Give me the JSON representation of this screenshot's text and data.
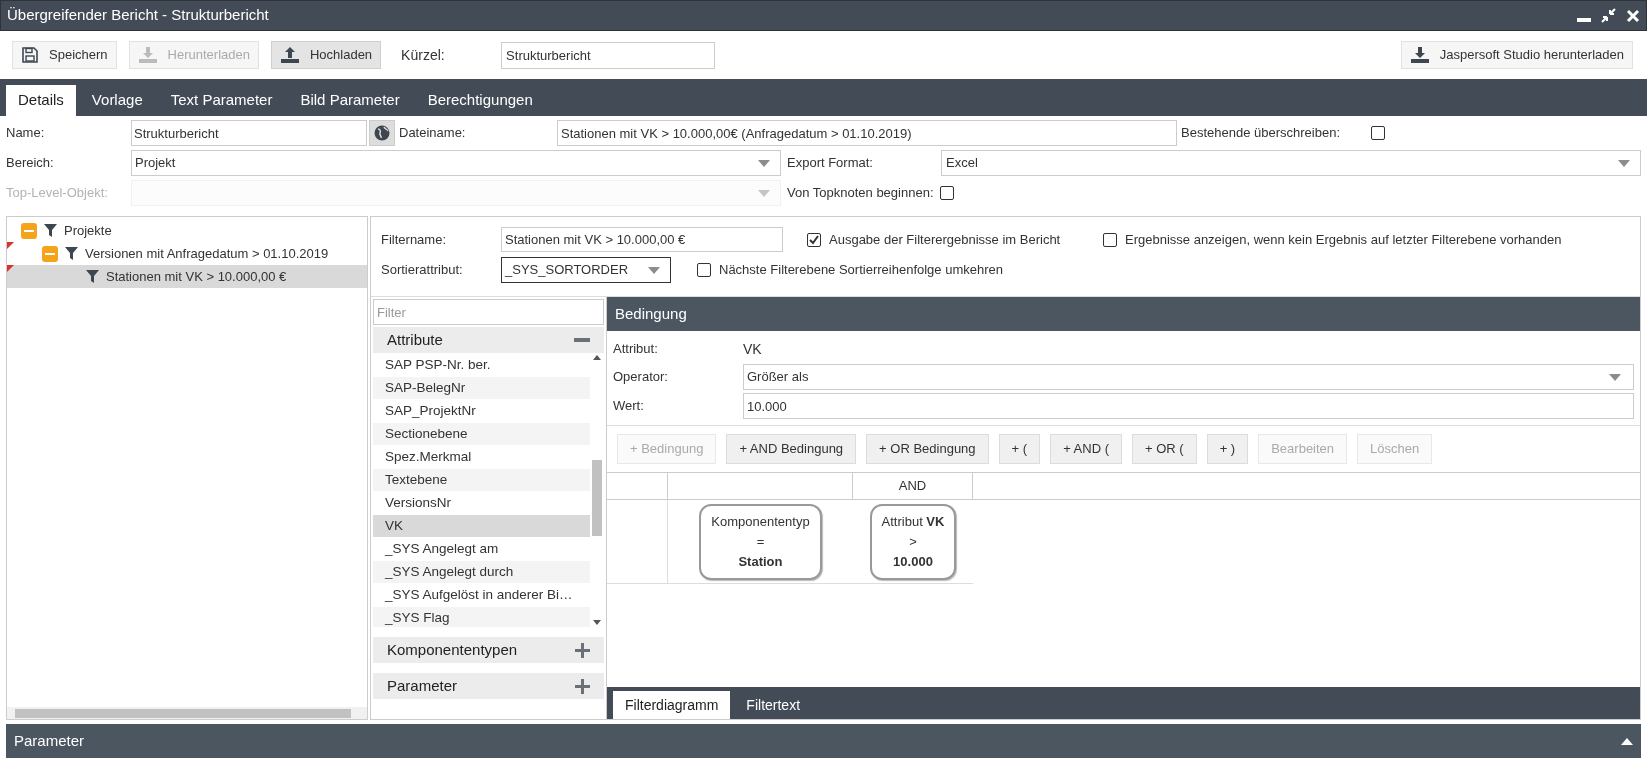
{
  "window": {
    "title": "Übergreifender Bericht - Strukturbericht"
  },
  "toolbar": {
    "buttons": [
      {
        "label": "Speichern",
        "kind": "save",
        "disabled": false,
        "pressed": false
      },
      {
        "label": "Herunterladen",
        "kind": "download",
        "disabled": true,
        "pressed": false
      },
      {
        "label": "Hochladen",
        "kind": "upload",
        "disabled": false,
        "pressed": true
      }
    ],
    "kuerzel": {
      "label": "Kürzel:",
      "value": "Strukturbericht"
    },
    "studio_button": "Jaspersoft Studio herunterladen"
  },
  "tabs": [
    {
      "label": "Details",
      "selected": true
    },
    {
      "label": "Vorlage",
      "selected": false
    },
    {
      "label": "Text Parameter",
      "selected": false
    },
    {
      "label": "Bild Parameter",
      "selected": false
    },
    {
      "label": "Berechtigungen",
      "selected": false
    }
  ],
  "form": {
    "name": {
      "label": "Name:",
      "value": "Strukturbericht"
    },
    "dateiname": {
      "label": "Dateiname:",
      "value": "Stationen mit VK > 10.000,00€ (Anfragedatum > 01.10.2019)"
    },
    "overwrite": {
      "label": "Bestehende überschreiben:",
      "checked": false
    },
    "bereich": {
      "label": "Bereich:",
      "value": "Projekt"
    },
    "export": {
      "label": "Export Format:",
      "value": "Excel"
    },
    "top_level": {
      "label": "Top-Level-Objekt:",
      "disabled": true
    },
    "topknoten": {
      "label": "Von Topknoten beginnen:",
      "checked": false
    }
  },
  "tree": [
    {
      "label": "Projekte",
      "expanded": true,
      "flagged": false,
      "selected": false,
      "children": [
        {
          "label": "Versionen mit Anfragedatum > 01.10.2019",
          "expanded": true,
          "flagged": true,
          "selected": false,
          "children": [
            {
              "label": "Stationen mit VK > 10.000,00 €",
              "flagged": true,
              "selected": true
            }
          ]
        }
      ]
    }
  ],
  "filter": {
    "filtername": {
      "label": "Filtername:",
      "value": "Stationen mit VK > 10.000,00 €"
    },
    "sort": {
      "label": "Sortierattribut:",
      "value": "_SYS_SORTORDER"
    },
    "output": {
      "label": "Ausgabe der Filterergebnisse im Bericht",
      "checked": true
    },
    "show_empty": {
      "label": "Ergebnisse anzeigen, wenn kein Ergebnis auf letzter Filterebene vorhanden",
      "checked": false
    },
    "reverse": {
      "label": "Nächste Filterebene Sortierreihenfolge umkehren",
      "checked": false
    }
  },
  "attributes": {
    "filter_placeholder": "Filter",
    "sections": [
      {
        "title": "Attribute",
        "expanded": true,
        "items": [
          {
            "label": "SAP PSP-Nr. ber.",
            "selected": false
          },
          {
            "label": "SAP-BelegNr",
            "selected": false
          },
          {
            "label": "SAP_ProjektNr",
            "selected": false
          },
          {
            "label": "Sectionebene",
            "selected": false
          },
          {
            "label": "Spez.Merkmal",
            "selected": false
          },
          {
            "label": "Textebene",
            "selected": false
          },
          {
            "label": "VersionsNr",
            "selected": false
          },
          {
            "label": "VK",
            "selected": true
          },
          {
            "label": "_SYS Angelegt am",
            "selected": false
          },
          {
            "label": "_SYS Angelegt durch",
            "selected": false
          },
          {
            "label": "_SYS Aufgelöst in anderer Bi…",
            "selected": false
          },
          {
            "label": "_SYS Flag",
            "selected": false
          }
        ]
      },
      {
        "title": "Komponententypen",
        "expanded": false
      },
      {
        "title": "Parameter",
        "expanded": false
      }
    ]
  },
  "condition": {
    "title": "Bedingung",
    "attribut": {
      "label": "Attribut:",
      "value": "VK"
    },
    "operator": {
      "label": "Operator:",
      "value": "Größer als"
    },
    "wert": {
      "label": "Wert:",
      "value": "10.000"
    },
    "buttons": [
      {
        "label": "+ Bedingung",
        "disabled": true
      },
      {
        "label": "+ AND Bedingung",
        "disabled": false
      },
      {
        "label": "+ OR Bedingung",
        "disabled": false
      },
      {
        "label": "+ (",
        "disabled": false
      },
      {
        "label": "+ AND (",
        "disabled": false
      },
      {
        "label": "+ OR (",
        "disabled": false
      },
      {
        "label": "+ )",
        "disabled": false
      },
      {
        "label": "Bearbeiten",
        "disabled": true
      },
      {
        "label": "Löschen",
        "disabled": true
      }
    ],
    "diagram": {
      "header": "AND",
      "nodes": [
        {
          "lines": [
            "Komponententyp",
            "=",
            "**Station**"
          ]
        },
        {
          "lines": [
            "Attribut **VK**",
            ">",
            "**10.000**"
          ]
        }
      ]
    },
    "bottom_tabs": [
      {
        "label": "Filterdiagramm",
        "selected": true
      },
      {
        "label": "Filtertext",
        "selected": false
      }
    ]
  },
  "parameter_bar": {
    "title": "Parameter"
  }
}
